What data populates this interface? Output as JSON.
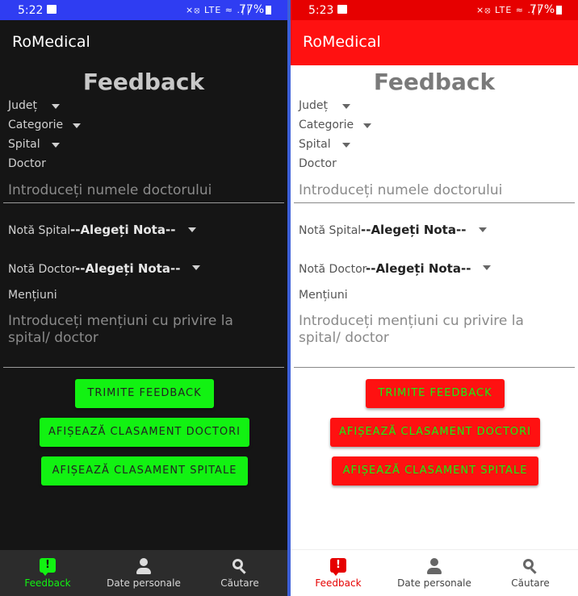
{
  "screens": [
    {
      "theme": "dark",
      "status": {
        "time": "5:22",
        "icons": "⨯⦻ LTE ≈ .∣∣",
        "battery": "77%"
      },
      "app_title": "RoMedical",
      "heading": "Feedback",
      "labels": {
        "judet": "Județ",
        "categorie": "Categorie",
        "spital": "Spital",
        "doctor": "Doctor",
        "nota_spital": "Notă Spital",
        "nota_doctor": "Notă Doctor",
        "mentiuni": "Mențiuni"
      },
      "doctor_placeholder": "Introduceți numele doctorului",
      "nota_spital_value": "--Alegeți Nota--",
      "nota_doctor_value": "--Alegeți Nota--",
      "mentiuni_placeholder": "Introduceți mențiuni cu privire la spital/ doctor",
      "buttons": {
        "trimite": "TRIMITE FEEDBACK",
        "clasament_doctori": "AFIȘEAZĂ CLASAMENT DOCTORI",
        "clasament_spitale": "AFIȘEAZĂ CLASAMENT SPITALE"
      },
      "nav": {
        "feedback": "Feedback",
        "date_personale": "Date personale",
        "cautare": "Căutare"
      },
      "colors": {
        "statusbar": "#2f3df2",
        "accent": "#12f212",
        "background": "#151515"
      }
    },
    {
      "theme": "light",
      "status": {
        "time": "5:23",
        "icons": "⨯⦻ LTE ≈ .∣∣",
        "battery": "77%"
      },
      "app_title": "RoMedical",
      "heading": "Feedback",
      "labels": {
        "judet": "Județ",
        "categorie": "Categorie",
        "spital": "Spital",
        "doctor": "Doctor",
        "nota_spital": "Notă Spital",
        "nota_doctor": "Notă Doctor",
        "mentiuni": "Mențiuni"
      },
      "doctor_placeholder": "Introduceți numele doctorului",
      "nota_spital_value": "--Alegeți Nota--",
      "nota_doctor_value": "--Alegeți Nota--",
      "mentiuni_placeholder": "Introduceți mențiuni cu privire la spital/ doctor",
      "buttons": {
        "trimite": "TRIMITE FEEDBACK",
        "clasament_doctori": "AFIȘEAZĂ CLASAMENT DOCTORI",
        "clasament_spitale": "AFIȘEAZĂ CLASAMENT SPITALE"
      },
      "nav": {
        "feedback": "Feedback",
        "date_personale": "Date personale",
        "cautare": "Căutare"
      },
      "colors": {
        "statusbar": "#e60000",
        "accent": "#ff1111",
        "background": "#ffffff"
      }
    }
  ]
}
